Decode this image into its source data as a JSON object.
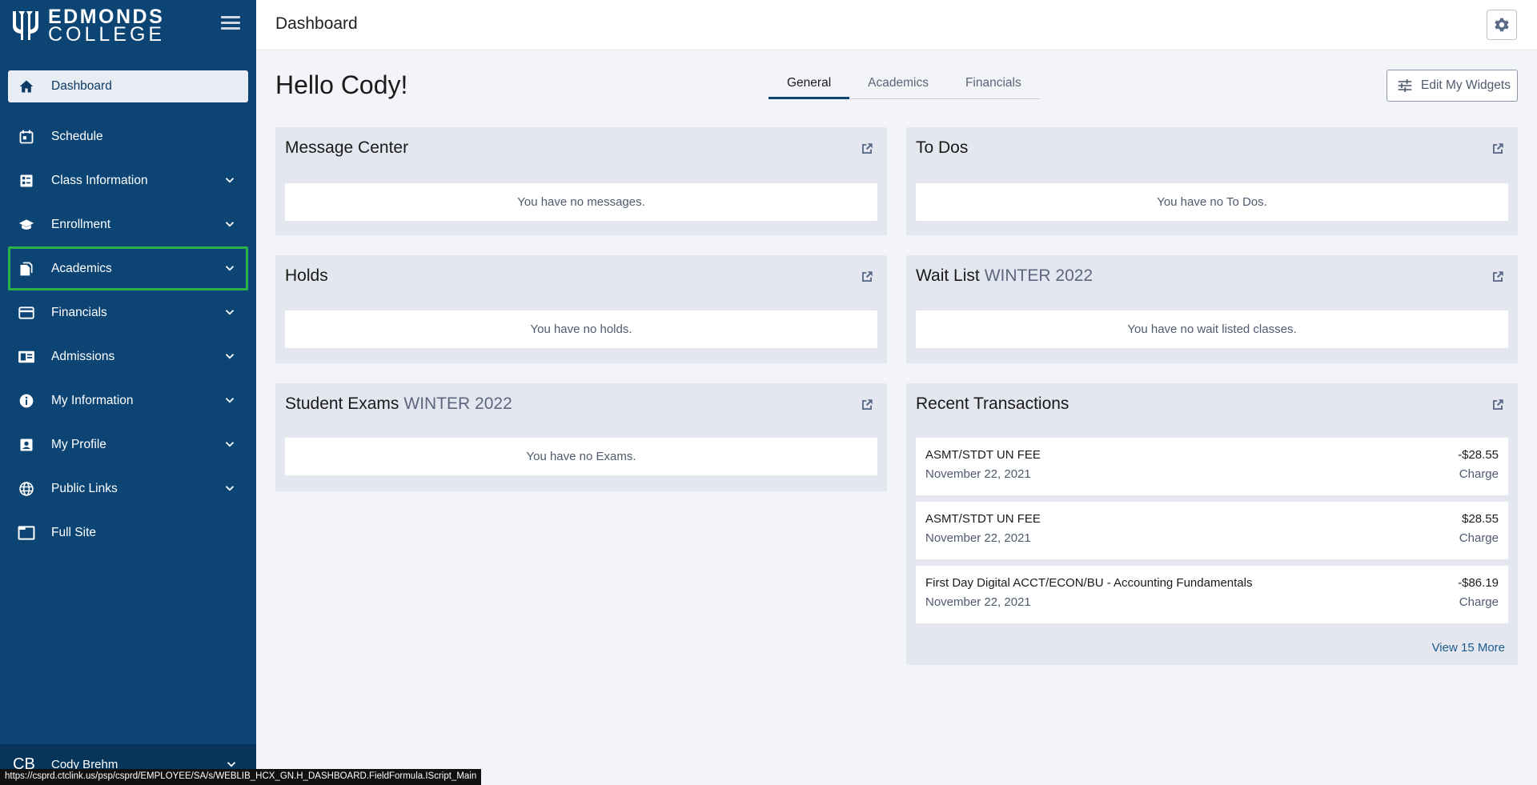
{
  "brand": {
    "line1": "EDMONDS",
    "line2": "COLLEGE"
  },
  "header": {
    "title": "Dashboard"
  },
  "sidebar": {
    "items": [
      {
        "label": "Dashboard",
        "icon": "home-icon"
      },
      {
        "label": "Schedule",
        "icon": "calendar-icon"
      },
      {
        "label": "Class Information",
        "icon": "class-list-icon"
      },
      {
        "label": "Enrollment",
        "icon": "graduation-cap-icon"
      },
      {
        "label": "Academics",
        "icon": "documents-icon"
      },
      {
        "label": "Financials",
        "icon": "credit-card-icon"
      },
      {
        "label": "Admissions",
        "icon": "id-card-icon"
      },
      {
        "label": "My Information",
        "icon": "info-icon"
      },
      {
        "label": "My Profile",
        "icon": "profile-badge-icon"
      },
      {
        "label": "Public Links",
        "icon": "globe-icon"
      },
      {
        "label": "Full Site",
        "icon": "window-icon"
      }
    ]
  },
  "user": {
    "initials": "CB",
    "name": "Cody Brehm"
  },
  "status_url": "https://csprd.ctclink.us/psp/csprd/EMPLOYEE/SA/s/WEBLIB_HCX_GN.H_DASHBOARD.FieldFormula.IScript_Main",
  "main": {
    "greeting": "Hello Cody!",
    "tabs": [
      {
        "label": "General"
      },
      {
        "label": "Academics"
      },
      {
        "label": "Financials"
      }
    ],
    "edit_widgets_label": "Edit My Widgets",
    "cards": {
      "message_center": {
        "title": "Message Center",
        "empty": "You have no messages."
      },
      "todos": {
        "title": "To Dos",
        "empty": "You have no To Dos."
      },
      "holds": {
        "title": "Holds",
        "empty": "You have no holds."
      },
      "waitlist": {
        "title": "Wait List",
        "term": "WINTER 2022",
        "empty": "You have no wait listed classes."
      },
      "exams": {
        "title": "Student Exams",
        "term": "WINTER 2022",
        "empty": "You have no Exams."
      },
      "transactions": {
        "title": "Recent Transactions",
        "items": [
          {
            "description": "ASMT/STDT UN FEE",
            "date": "November 22, 2021",
            "amount": "-$28.55",
            "type": "Charge"
          },
          {
            "description": "ASMT/STDT UN FEE",
            "date": "November 22, 2021",
            "amount": "$28.55",
            "type": "Charge"
          },
          {
            "description": "First Day Digital ACCT/ECON/BU - Accounting Fundamentals",
            "date": "November 22, 2021",
            "amount": "-$86.19",
            "type": "Charge"
          }
        ],
        "view_more": "View 15 More"
      }
    }
  },
  "colors": {
    "sidebar_bg": "#0c4474",
    "focus_outline": "#2db24a",
    "card_bg": "#e4e7f0",
    "page_bg": "#f3f4f8"
  }
}
